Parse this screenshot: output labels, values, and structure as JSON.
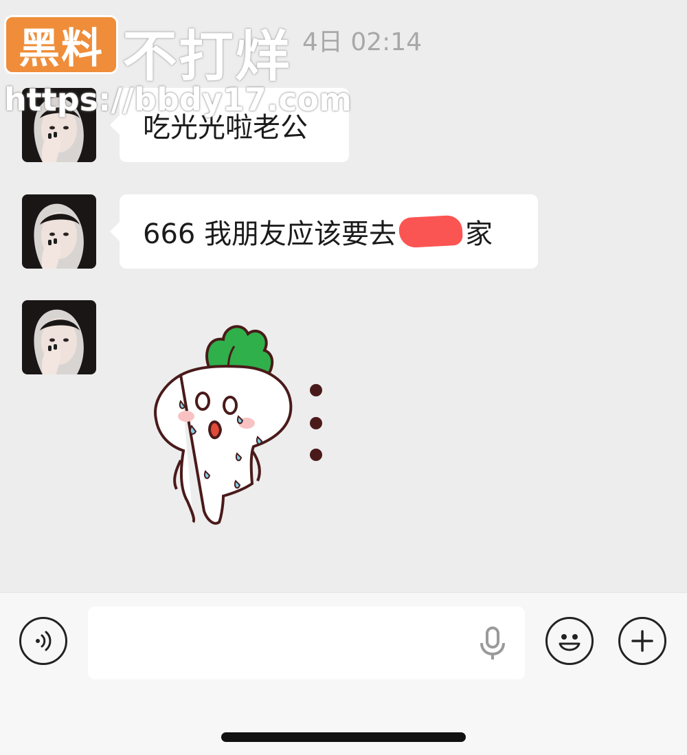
{
  "watermark": {
    "badge_text": "黑料",
    "title": "不打烊",
    "url": "https://bbdy17.com"
  },
  "chat": {
    "timestamp": "4日 02:14",
    "messages": [
      {
        "type": "text",
        "text": "吃光光啦老公"
      },
      {
        "type": "text",
        "text_before_redaction": "666 我朋友应该要去",
        "text_after_redaction": "家"
      },
      {
        "type": "sticker",
        "description": "crying-radish-sticker"
      }
    ]
  },
  "input_bar": {
    "voice_icon": "voice-toggle-icon",
    "mic_icon": "microphone-icon",
    "emoji_icon": "emoji-icon",
    "add_icon": "plus-icon",
    "text_value": ""
  }
}
